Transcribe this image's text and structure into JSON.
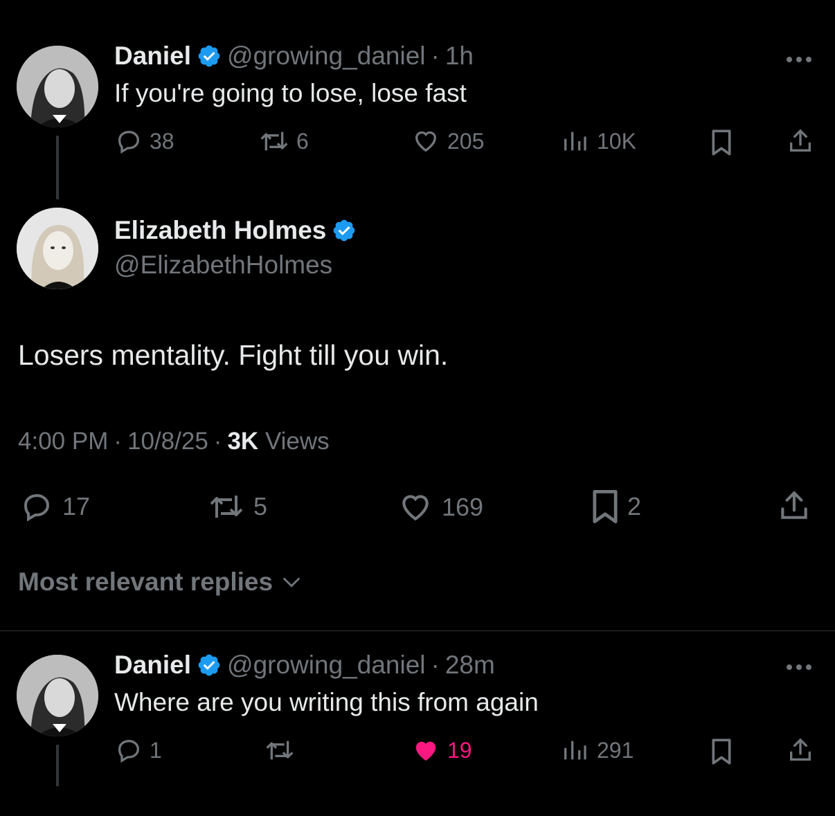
{
  "tweet1": {
    "name": "Daniel",
    "handle": "@growing_daniel",
    "time": "1h",
    "text": "If you're going to lose, lose fast",
    "replies": "38",
    "reposts": "6",
    "likes": "205",
    "views": "10K"
  },
  "main": {
    "name": "Elizabeth Holmes",
    "handle": "@ElizabethHolmes",
    "text": "Losers mentality. Fight till you win.",
    "time": "4:00 PM",
    "date": "10/8/25",
    "views_count": "3K",
    "views_label": "Views",
    "replies": "17",
    "reposts": "5",
    "likes": "169",
    "bookmarks": "2"
  },
  "replies_sort": {
    "label": "Most relevant replies"
  },
  "tweet2": {
    "name": "Daniel",
    "handle": "@growing_daniel",
    "time": "28m",
    "text": "Where are you writing this from again",
    "replies": "1",
    "likes": "19",
    "views": "291"
  },
  "colors": {
    "background": "#000000",
    "text": "#e7e9ea",
    "muted": "#71767b",
    "verified": "#1d9bf0",
    "liked": "#f91880"
  }
}
